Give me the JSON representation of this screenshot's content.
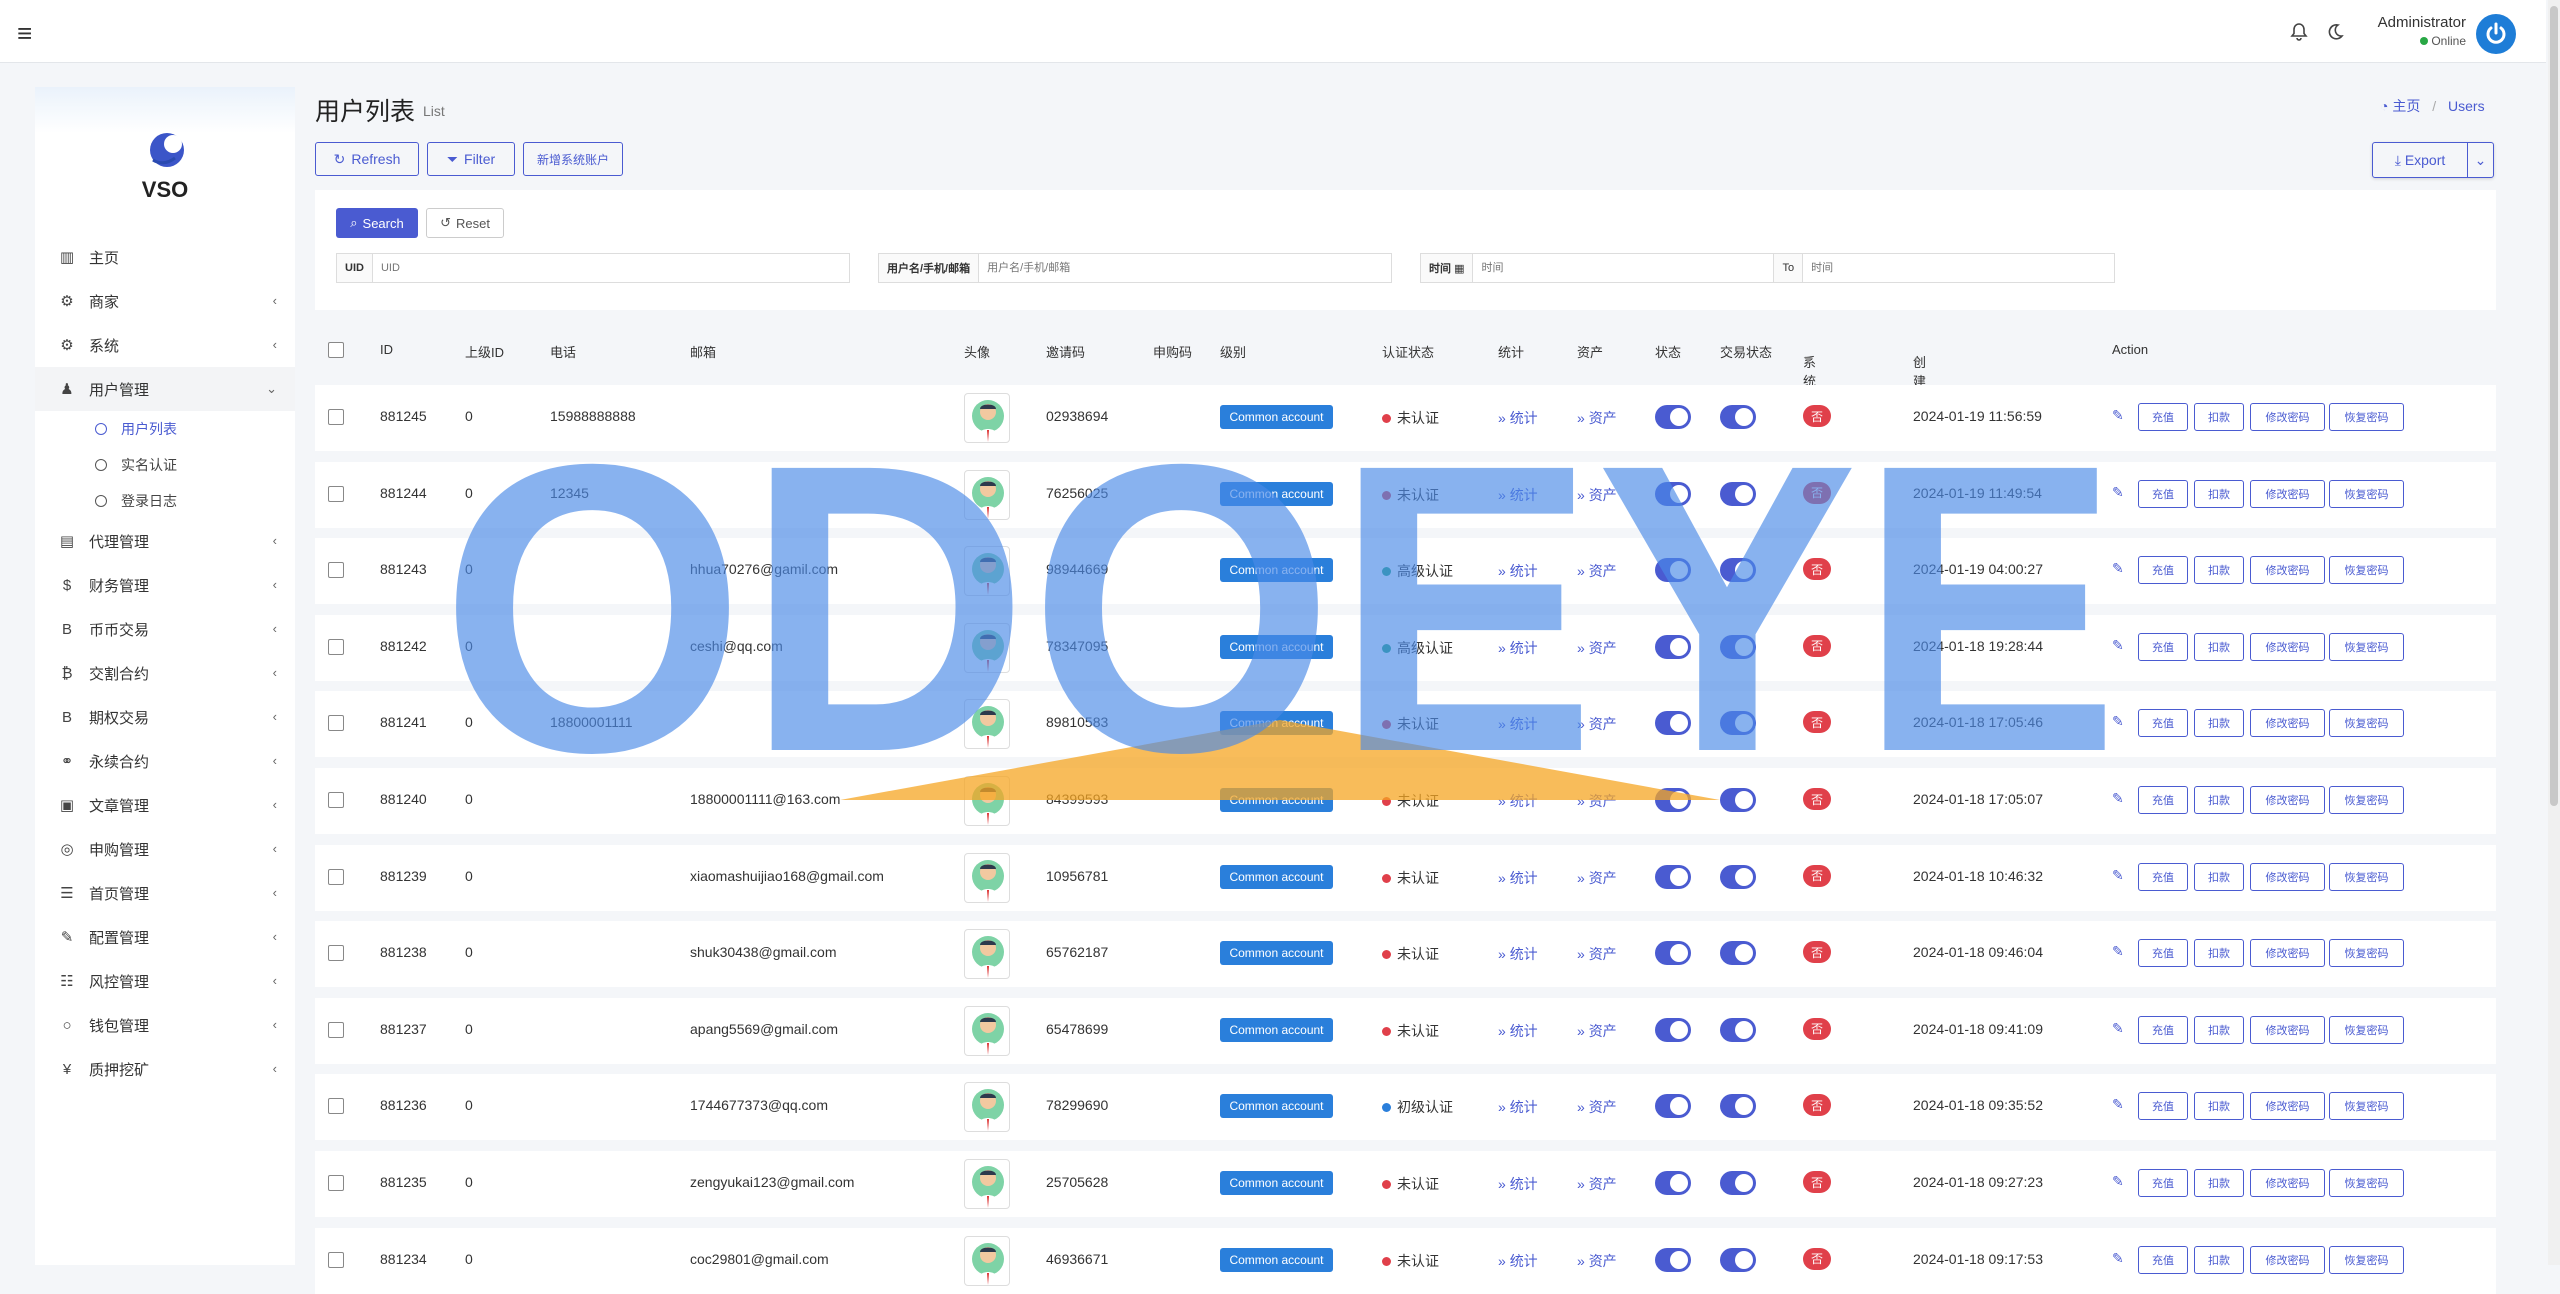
{
  "header": {
    "user_name": "Administrator",
    "user_status": "Online"
  },
  "sidebar": {
    "brand": "VSO",
    "items": [
      {
        "label": "主页",
        "icon": "bar-chart-icon",
        "glyph": "▥",
        "chevron": false
      },
      {
        "label": "商家",
        "icon": "users-gear-icon",
        "glyph": "⚙",
        "chevron": true
      },
      {
        "label": "系统",
        "icon": "gear-icon",
        "glyph": "⚙",
        "chevron": true
      },
      {
        "label": "用户管理",
        "icon": "user-icon",
        "glyph": "♟",
        "chevron": true,
        "expanded": true
      },
      {
        "label": "代理管理",
        "icon": "id-card-icon",
        "glyph": "▤",
        "chevron": true
      },
      {
        "label": "财务管理",
        "icon": "dollar-icon",
        "glyph": "$",
        "chevron": true
      },
      {
        "label": "币币交易",
        "icon": "bitcoin-icon",
        "glyph": "B",
        "chevron": true
      },
      {
        "label": "交割合约",
        "icon": "bitcoin-circle-icon",
        "glyph": "₿",
        "chevron": true
      },
      {
        "label": "期权交易",
        "icon": "bitcoin-icon",
        "glyph": "B",
        "chevron": true
      },
      {
        "label": "永续合约",
        "icon": "link-icon",
        "glyph": "⚭",
        "chevron": true
      },
      {
        "label": "文章管理",
        "icon": "newspaper-icon",
        "glyph": "▣",
        "chevron": true
      },
      {
        "label": "申购管理",
        "icon": "lifebuoy-icon",
        "glyph": "◎",
        "chevron": true
      },
      {
        "label": "首页管理",
        "icon": "list-icon",
        "glyph": "☰",
        "chevron": true
      },
      {
        "label": "配置管理",
        "icon": "wrench-icon",
        "glyph": "✎",
        "chevron": true
      },
      {
        "label": "风控管理",
        "icon": "list-alt-icon",
        "glyph": "☷",
        "chevron": true
      },
      {
        "label": "钱包管理",
        "icon": "circle-icon",
        "glyph": "○",
        "chevron": true
      },
      {
        "label": "质押挖矿",
        "icon": "yen-icon",
        "glyph": "¥",
        "chevron": true
      }
    ],
    "subitems": [
      {
        "label": "用户列表",
        "active": true
      },
      {
        "label": "实名认证",
        "active": false
      },
      {
        "label": "登录日志",
        "active": false
      }
    ]
  },
  "page": {
    "title": "用户列表",
    "subtitle": "List",
    "breadcrumb_home": "主页",
    "breadcrumb_current": "Users"
  },
  "toolbar": {
    "refresh": "Refresh",
    "filter": "Filter",
    "add_system_account": "新增系统账户",
    "export": "Export"
  },
  "search": {
    "search_btn": "Search",
    "reset_btn": "Reset",
    "uid_label": "UID",
    "uid_placeholder": "UID",
    "account_label": "用户名/手机/邮箱",
    "account_placeholder": "用户名/手机/邮箱",
    "time_label": "时间",
    "time_start_placeholder": "时间",
    "time_to": "To",
    "time_end_placeholder": "时间"
  },
  "table": {
    "columns": [
      "ID",
      "上级ID",
      "电话",
      "邮箱",
      "头像",
      "邀请码",
      "申购码",
      "级别",
      "认证状态",
      "统计",
      "资产",
      "状态",
      "交易状态",
      "系统账户",
      "创建时间",
      "Action"
    ],
    "link_stats": "统计",
    "link_assets": "资产",
    "level_label": "Common account",
    "system_no": "否",
    "actions": [
      "充值",
      "扣款",
      "修改密码",
      "恢复密码"
    ],
    "rows": [
      {
        "id": "881245",
        "parent": "0",
        "phone": "15988888888",
        "email": "",
        "invite": "02938694",
        "auth": "未认证",
        "auth_color": "#e0404a",
        "created": "2024-01-19 11:56:59"
      },
      {
        "id": "881244",
        "parent": "0",
        "phone": "12345",
        "email": "",
        "invite": "76256025",
        "auth": "未认证",
        "auth_color": "#e0404a",
        "created": "2024-01-19 11:49:54"
      },
      {
        "id": "881243",
        "parent": "0",
        "phone": "",
        "email": "hhua70276@gamil.com",
        "invite": "98944669",
        "auth": "高级认证",
        "auth_color": "#1fa57a",
        "created": "2024-01-19 04:00:27"
      },
      {
        "id": "881242",
        "parent": "0",
        "phone": "",
        "email": "ceshi@qq.com",
        "invite": "78347095",
        "auth": "高级认证",
        "auth_color": "#1fa57a",
        "created": "2024-01-18 19:28:44"
      },
      {
        "id": "881241",
        "parent": "0",
        "phone": "18800001111",
        "email": "",
        "invite": "89810583",
        "auth": "未认证",
        "auth_color": "#e0404a",
        "created": "2024-01-18 17:05:46"
      },
      {
        "id": "881240",
        "parent": "0",
        "phone": "",
        "email": "18800001111@163.com",
        "invite": "84399593",
        "auth": "未认证",
        "auth_color": "#e0404a",
        "created": "2024-01-18 17:05:07"
      },
      {
        "id": "881239",
        "parent": "0",
        "phone": "",
        "email": "xiaomashuijiao168@gmail.com",
        "invite": "10956781",
        "auth": "未认证",
        "auth_color": "#e0404a",
        "created": "2024-01-18 10:46:32"
      },
      {
        "id": "881238",
        "parent": "0",
        "phone": "",
        "email": "shuk30438@gmail.com",
        "invite": "65762187",
        "auth": "未认证",
        "auth_color": "#e0404a",
        "created": "2024-01-18 09:46:04"
      },
      {
        "id": "881237",
        "parent": "0",
        "phone": "",
        "email": "apang5569@gmail.com",
        "invite": "65478699",
        "auth": "未认证",
        "auth_color": "#e0404a",
        "created": "2024-01-18 09:41:09"
      },
      {
        "id": "881236",
        "parent": "0",
        "phone": "",
        "email": "1744677373@qq.com",
        "invite": "78299690",
        "auth": "初级认证",
        "auth_color": "#2a7fdb",
        "created": "2024-01-18 09:35:52"
      },
      {
        "id": "881235",
        "parent": "0",
        "phone": "",
        "email": "zengyukai123@gmail.com",
        "invite": "25705628",
        "auth": "未认证",
        "auth_color": "#e0404a",
        "created": "2024-01-18 09:27:23"
      },
      {
        "id": "881234",
        "parent": "0",
        "phone": "",
        "email": "coc29801@gmail.com",
        "invite": "46936671",
        "auth": "未认证",
        "auth_color": "#e0404a",
        "created": "2024-01-18 09:17:53"
      }
    ]
  },
  "watermark": {
    "text": "ODOEYE",
    "color": "#4a8ae8",
    "accent": "#f5a623"
  }
}
